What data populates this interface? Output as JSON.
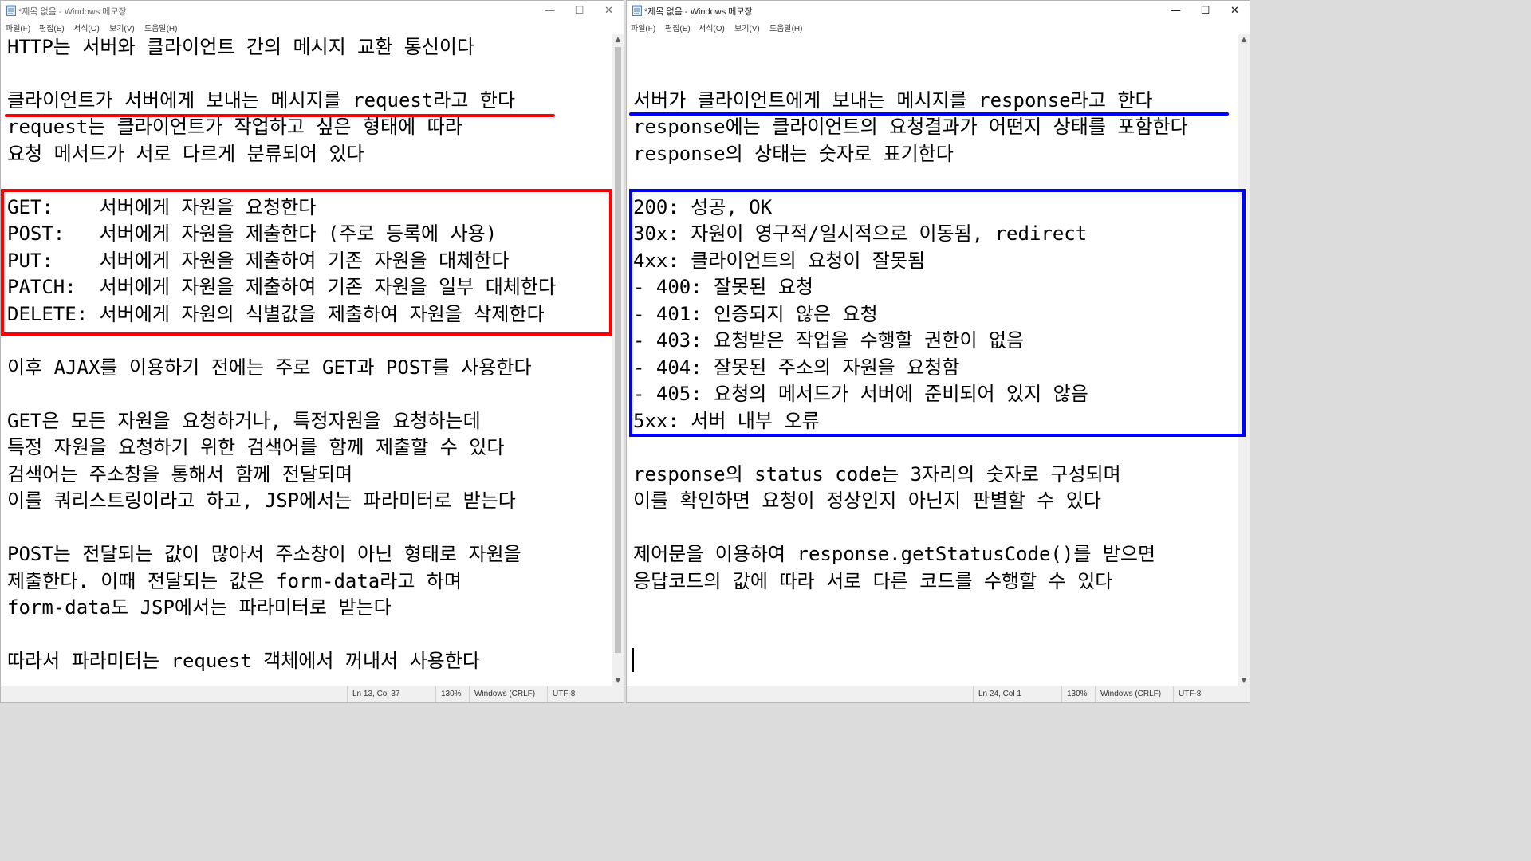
{
  "colors": {
    "red_annotation": "#ff0000",
    "blue_annotation": "#0000ff",
    "text": "#000000",
    "chrome": "#f0f0f0"
  },
  "left_window": {
    "title": "*제목 없음 - Windows 메모장",
    "icons": {
      "app": "notepad-icon",
      "minimize": "minimize-icon",
      "maximize": "maximize-icon",
      "close": "close-icon"
    },
    "menu": [
      "파일(F)",
      "편집(E)",
      "서식(O)",
      "보기(V)",
      "도움말(H)"
    ],
    "lines": [
      "HTTP는 서버와 클라이언트 간의 메시지 교환 통신이다",
      "",
      "클라이언트가 서버에게 보내는 메시지를 request라고 한다",
      "request는 클라이언트가 작업하고 싶은 형태에 따라",
      "요청 메서드가 서로 다르게 분류되어 있다",
      "",
      "GET:    서버에게 자원을 요청한다",
      "POST:   서버에게 자원을 제출한다 (주로 등록에 사용)",
      "PUT:    서버에게 자원을 제출하여 기존 자원을 대체한다",
      "PATCH:  서버에게 자원을 제출하여 기존 자원을 일부 대체한다",
      "DELETE: 서버에게 자원의 식별값을 제출하여 자원을 삭제한다",
      "",
      "이후 AJAX를 이용하기 전에는 주로 GET과 POST를 사용한다",
      "",
      "GET은 모든 자원을 요청하거나, 특정자원을 요청하는데",
      "특정 자원을 요청하기 위한 검색어를 함께 제출할 수 있다",
      "검색어는 주소창을 통해서 함께 전달되며",
      "이를 쿼리스트링이라고 하고, JSP에서는 파라미터로 받는다",
      "",
      "POST는 전달되는 값이 많아서 주소창이 아닌 형태로 자원을",
      "제출한다. 이때 전달되는 값은 form-data라고 하며",
      "form-data도 JSP에서는 파라미터로 받는다",
      "",
      "따라서 파라미터는 request 객체에서 꺼내서 사용한다"
    ],
    "status": {
      "position": "Ln 13, Col 37",
      "zoom": "130%",
      "line_ending": "Windows (CRLF)",
      "encoding": "UTF-8"
    }
  },
  "right_window": {
    "title": "*제목 없음 - Windows 메모장",
    "icons": {
      "app": "notepad-icon",
      "minimize": "minimize-icon",
      "maximize": "maximize-icon",
      "close": "close-icon"
    },
    "menu": [
      "파일(F)",
      "편집(E)",
      "서식(O)",
      "보기(V)",
      "도움말(H)"
    ],
    "lines": [
      "",
      "",
      "서버가 클라이언트에게 보내는 메시지를 response라고 한다",
      "response에는 클라이언트의 요청결과가 어떤지 상태를 포함한다",
      "response의 상태는 숫자로 표기한다",
      "",
      "200: 성공, OK",
      "30x: 자원이 영구적/일시적으로 이동됨, redirect",
      "4xx: 클라이언트의 요청이 잘못됨",
      "- 400: 잘못된 요청",
      "- 401: 인증되지 않은 요청",
      "- 403: 요청받은 작업을 수행할 권한이 없음",
      "- 404: 잘못된 주소의 자원을 요청함",
      "- 405: 요청의 메서드가 서버에 준비되어 있지 않음",
      "5xx: 서버 내부 오류",
      "",
      "response의 status code는 3자리의 숫자로 구성되며",
      "이를 확인하면 요청이 정상인지 아닌지 판별할 수 있다",
      "",
      "제어문을 이용하여 response.getStatusCode()를 받으면",
      "응답코드의 값에 따라 서로 다른 코드를 수행할 수 있다"
    ],
    "status": {
      "position": "Ln 24, Col 1",
      "zoom": "130%",
      "line_ending": "Windows (CRLF)",
      "encoding": "UTF-8"
    }
  }
}
